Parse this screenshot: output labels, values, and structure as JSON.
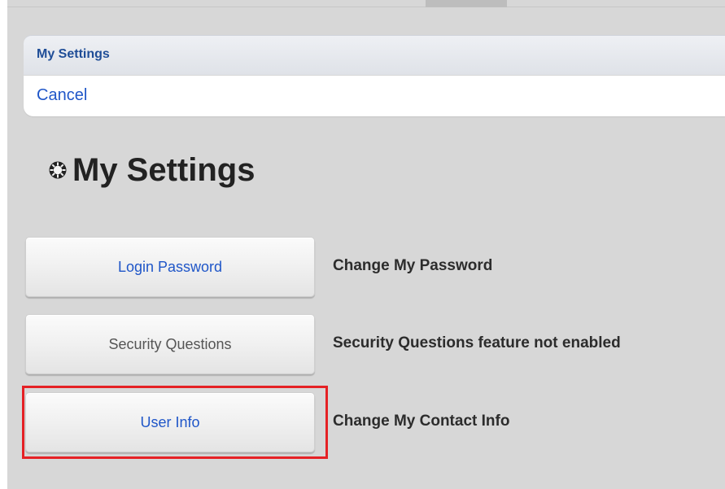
{
  "header": {
    "title": "My Settings"
  },
  "action_bar": {
    "cancel_label": "Cancel"
  },
  "page": {
    "title": "My Settings",
    "title_icon": "gear-icon"
  },
  "settings": [
    {
      "button_label": "Login Password",
      "description": "Change My Password",
      "enabled": true
    },
    {
      "button_label": "Security Questions",
      "description": "Security Questions feature not enabled",
      "enabled": false
    },
    {
      "button_label": "User Info",
      "description": "Change My Contact Info",
      "enabled": true,
      "highlighted": true
    }
  ],
  "colors": {
    "link_blue": "#1f56c8",
    "header_blue": "#1f4d97",
    "highlight_red": "#e52125",
    "background_gray": "#d7d7d7"
  }
}
